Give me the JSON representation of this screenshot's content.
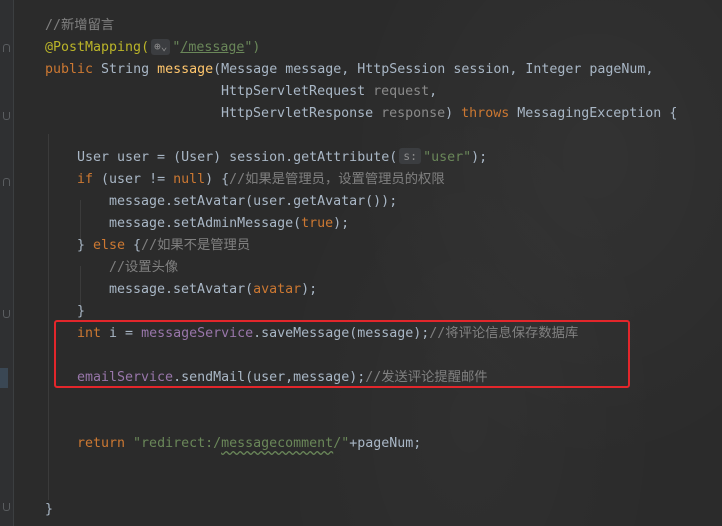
{
  "code": {
    "comment_new_message": "//新增留言",
    "annotation": "@PostMapping(",
    "web_icon": "⊕⌄",
    "mapping_path_quote_open": "\"",
    "mapping_path": "/message",
    "mapping_path_quote_close": "\")",
    "sig_public": "public ",
    "sig_type_string": "String ",
    "sig_method": "message",
    "sig_paren": "(",
    "sig_params_1": "Message message, HttpSession session, Integer pageNum,",
    "sig_params_2_type": "HttpServletRequest ",
    "sig_params_2_name": "request",
    "sig_params_2_comma": ",",
    "sig_params_3_type": "HttpServletResponse ",
    "sig_params_3_name": "response",
    "sig_params_3_close": ") ",
    "sig_throws": "throws ",
    "sig_exception": "MessagingException {",
    "l1_a": "User user = (User) session.getAttribute(",
    "l1_hint": "s:",
    "l1_str": "\"user\"",
    "l1_end": ");",
    "l2_if": "if ",
    "l2_a": "(user != ",
    "l2_null": "null",
    "l2_b": ") {",
    "l2_cm": "//如果是管理员，设置管理员的权限",
    "l3": "message.setAvatar(user.getAvatar());",
    "l4_a": "message.setAdminMessage(",
    "l4_true": "true",
    "l4_b": ");",
    "l5_a": "} ",
    "l5_else": "else ",
    "l5_b": "{",
    "l5_cm": "//如果不是管理员",
    "l6_cm": "//设置头像",
    "l7_a": "message.setAvatar(",
    "l7_param": "avatar",
    "l7_b": ");",
    "l8": "}",
    "l9_int": "int ",
    "l9_a": "i = ",
    "l9_svc": "messageService",
    "l9_b": ".saveMessage(message);",
    "l9_cm": "//将评论信息保存数据库",
    "l10_svc": "emailService",
    "l10_b": ".sendMail(user,message);",
    "l10_cm": "//发送评论提醒邮件",
    "l11_return": "return ",
    "l11_str_a": "\"redirect:/",
    "l11_str_b": "messagecomment",
    "l11_str_c": "/\"",
    "l11_b": "+pageNum;",
    "l12": "}"
  },
  "colors": {
    "background": "#2b2b2b",
    "keyword": "#cc7832",
    "string": "#6a8759",
    "comment": "#808080",
    "method": "#ffc66d",
    "annotation": "#bbb529",
    "field": "#9876aa",
    "highlight_border": "#e3262b"
  }
}
